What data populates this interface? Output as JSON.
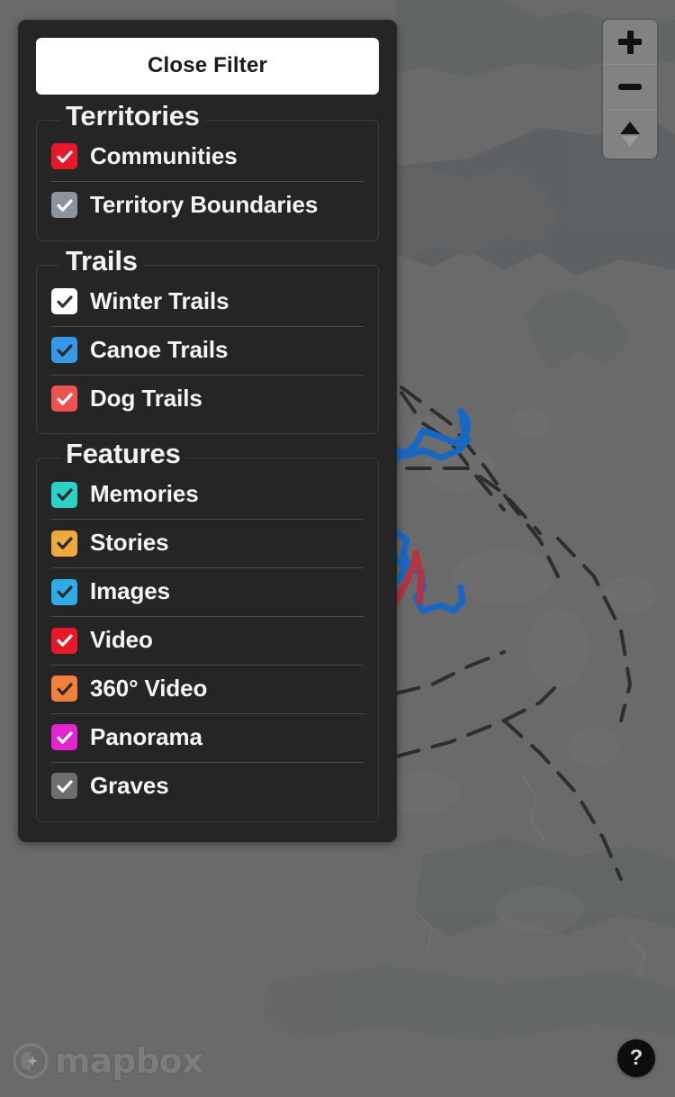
{
  "panel": {
    "close_button_label": "Close Filter",
    "groups": [
      {
        "title": "Territories",
        "items": [
          {
            "label": "Communities",
            "checked": true,
            "box_color": "#e8172a",
            "check_color": "#ffffff"
          },
          {
            "label": "Territory Boundaries",
            "checked": true,
            "box_color": "#8b939d",
            "check_color": "#ffffff"
          }
        ]
      },
      {
        "title": "Trails",
        "items": [
          {
            "label": "Winter Trails",
            "checked": true,
            "box_color": "#ffffff",
            "check_color": "#333333"
          },
          {
            "label": "Canoe Trails",
            "checked": true,
            "box_color": "#3797e8",
            "check_color": "#2b2b2b"
          },
          {
            "label": "Dog Trails",
            "checked": true,
            "box_color": "#ef5350",
            "check_color": "#ffffff"
          }
        ]
      },
      {
        "title": "Features",
        "items": [
          {
            "label": "Memories",
            "checked": true,
            "box_color": "#2bd1c4",
            "check_color": "#2b2b2b"
          },
          {
            "label": "Stories",
            "checked": true,
            "box_color": "#eda93b",
            "check_color": "#2b2b2b"
          },
          {
            "label": "Images",
            "checked": true,
            "box_color": "#2eabe8",
            "check_color": "#2b2b2b"
          },
          {
            "label": "Video",
            "checked": true,
            "box_color": "#e8172a",
            "check_color": "#ffffff"
          },
          {
            "label": "360° Video",
            "checked": true,
            "box_color": "#f0803c",
            "check_color": "#2b2b2b"
          },
          {
            "label": "Panorama",
            "checked": true,
            "box_color": "#e225cf",
            "check_color": "#ffffff"
          },
          {
            "label": "Graves",
            "checked": true,
            "box_color": "#6e6e6e",
            "check_color": "#ffffff"
          }
        ]
      }
    ]
  },
  "map_controls": {
    "zoom_in_label": "+",
    "zoom_out_label": "−",
    "compass_label": "Reset bearing to north"
  },
  "attribution": {
    "logo_text": "mapbox"
  },
  "help": {
    "label": "?"
  },
  "colors": {
    "panel_bg": "#252525",
    "map_bg": "#6a6a6a",
    "water": "#555a5c",
    "canoe_trail": "#1668c4",
    "dog_trail": "#b8333f",
    "boundary": "#2e2e2e"
  }
}
